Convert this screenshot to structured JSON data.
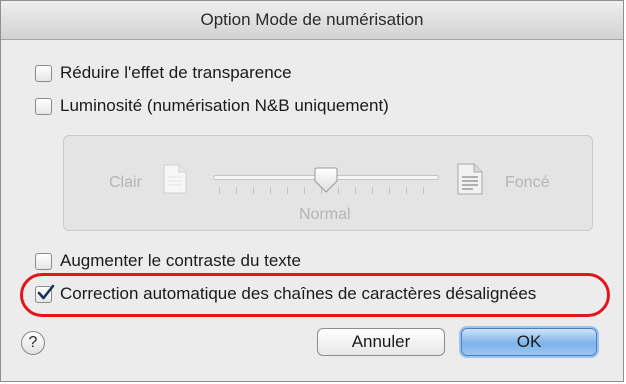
{
  "dialog": {
    "title": "Option Mode de numérisation"
  },
  "options": [
    {
      "label": "Réduire l'effet de transparence",
      "checked": false
    },
    {
      "label": "Luminosité (numérisation N&B uniquement)",
      "checked": false
    },
    {
      "label": "Augmenter le contraste du texte",
      "checked": false
    },
    {
      "label": "Correction automatique des chaînes de caractères désalignées",
      "checked": true
    }
  ],
  "brightness": {
    "light_label": "Clair",
    "dark_label": "Foncé",
    "mid_label": "Normal",
    "value_fraction": 0.5,
    "enabled": false
  },
  "buttons": {
    "help": "?",
    "cancel": "Annuler",
    "ok": "OK"
  },
  "colors": {
    "highlight": "#e4141b",
    "default_button": "#7fb3ea"
  }
}
